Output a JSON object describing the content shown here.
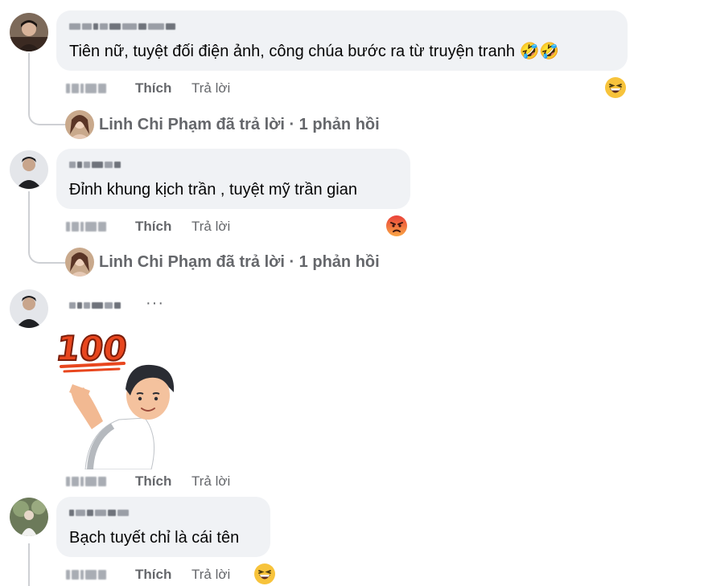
{
  "comments": [
    {
      "text": "Tiên nữ, tuyệt đối điện ảnh, công chúa bước ra từ truyện tranh 🤣🤣",
      "like_label": "Thích",
      "reply_label": "Trả lời",
      "reaction_icon": "grinning-squinting-face-icon",
      "replies_summary": "Linh Chi Phạm đã trả lời · 1 phản hồi"
    },
    {
      "text": "Đỉnh khung kịch trần , tuyệt mỹ trần gian",
      "like_label": "Thích",
      "reply_label": "Trả lời",
      "reaction_icon": "angry-face-icon",
      "replies_summary": "Linh Chi Phạm đã trả lời · 1 phản hồi"
    },
    {
      "more_label": "···",
      "sticker_text": "100",
      "sticker_icon": "sticker-100-boy-pointing",
      "like_label": "Thích",
      "reply_label": "Trả lời"
    },
    {
      "text": "Bạch tuyết chỉ là cái tên",
      "like_label": "Thích",
      "reply_label": "Trả lời",
      "reaction_icon": "grinning-squinting-face-icon"
    }
  ],
  "colors": {
    "bubble": "#f0f2f5",
    "secondary_text": "#65676b",
    "haha_yellow": "#f7c33b",
    "angry_red": "#e9413a",
    "thread_line": "#ced0d4"
  }
}
